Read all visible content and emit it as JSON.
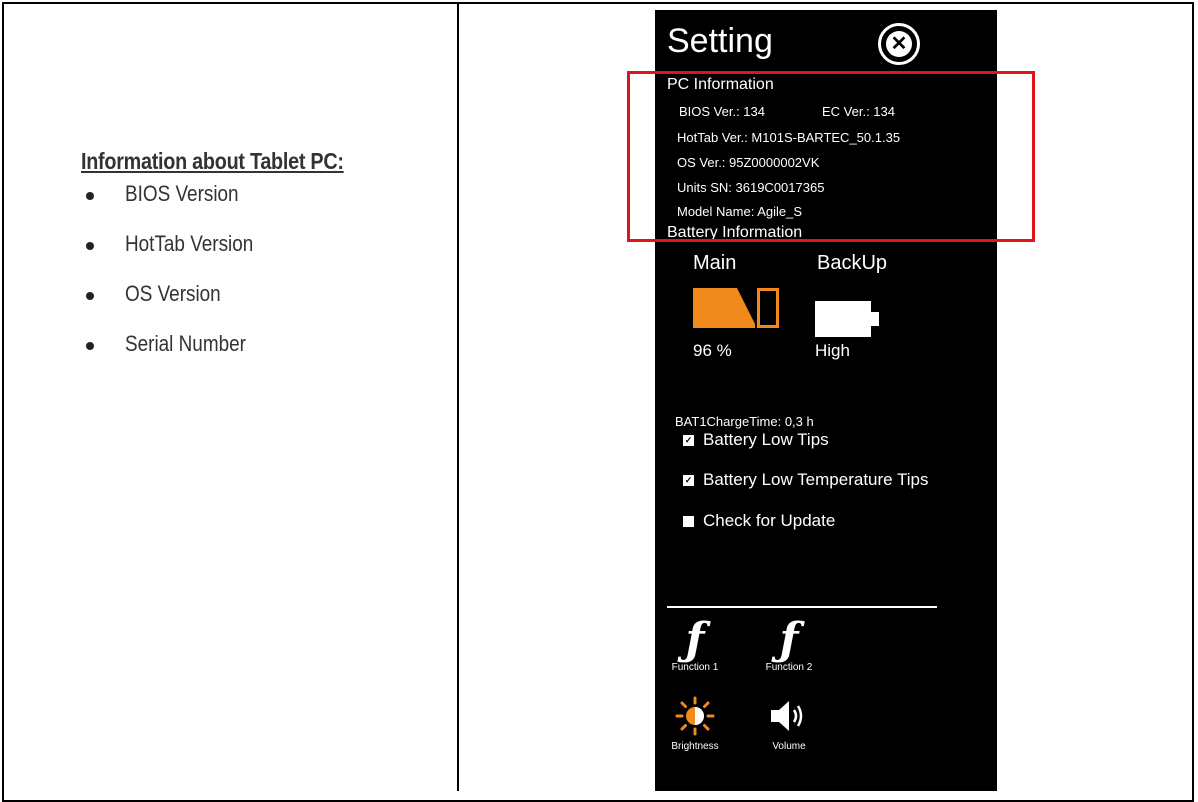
{
  "left": {
    "title": "Information about Tablet PC:",
    "bullets": [
      "BIOS Version",
      "HotTab Version",
      "OS Version",
      "Serial Number"
    ]
  },
  "panel": {
    "title": "Setting",
    "close_icon": "close-circle-icon",
    "pc_info": {
      "heading": "PC Information",
      "bios": "BIOS Ver.: 134",
      "ec": "EC Ver.: 134",
      "hottab": "HotTab Ver.: M101S-BARTEC_50.1.35",
      "os": "OS Ver.: 95Z0000002VK",
      "sn": "Units SN: 3619C0017365",
      "model": "Model Name: Agile_S"
    },
    "battery": {
      "heading": "Battery Information",
      "main_label": "Main",
      "backup_label": "BackUp",
      "main_value": "96 %",
      "backup_value": "High",
      "charge_time": "BAT1ChargeTime: 0,3 h",
      "main_color": "#f08a1c"
    },
    "options": [
      {
        "label": "Battery Low Tips",
        "checked": true
      },
      {
        "label": "Battery Low Temperature Tips",
        "checked": true
      },
      {
        "label": "Check for Update",
        "checked": false
      }
    ],
    "functions": [
      {
        "label": "Function 1",
        "icon": "function-icon"
      },
      {
        "label": "Function 2",
        "icon": "function-icon"
      },
      {
        "label": "Brightness",
        "icon": "brightness-icon"
      },
      {
        "label": "Volume",
        "icon": "volume-icon"
      }
    ],
    "highlight_color": "#e0151c"
  }
}
